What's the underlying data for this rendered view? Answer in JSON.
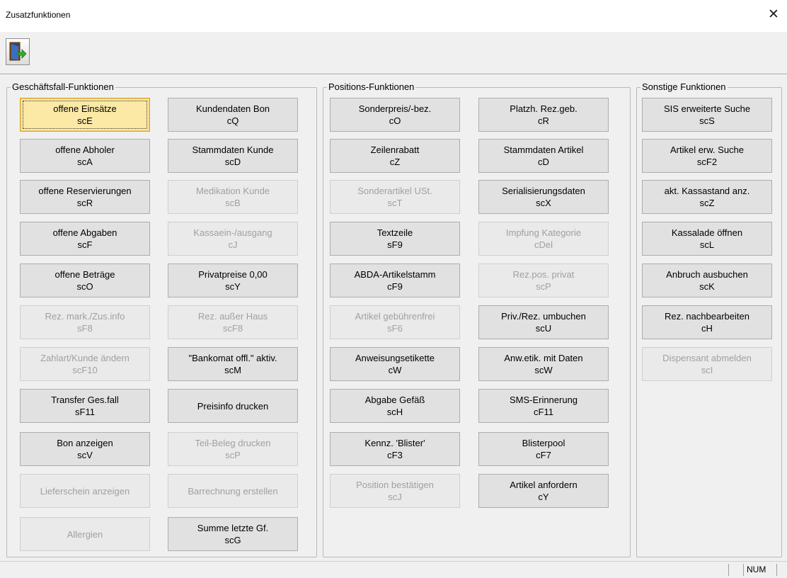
{
  "window": {
    "title": "Zusatzfunktionen",
    "close": "✕"
  },
  "toolbar": {
    "exit_icon": "exit-door-icon"
  },
  "groups": {
    "geschaeftsfall": {
      "label": "Geschäftsfall-Funktionen",
      "buttons": [
        {
          "line1": "offene Einsätze",
          "line2": "scE"
        },
        {
          "line1": "Kundendaten Bon",
          "line2": "cQ"
        },
        {
          "line1": "offene Abholer",
          "line2": "scA"
        },
        {
          "line1": "Stammdaten Kunde",
          "line2": "scD"
        },
        {
          "line1": "offene Reservierungen",
          "line2": "scR"
        },
        {
          "line1": "Medikation Kunde",
          "line2": "scB"
        },
        {
          "line1": "offene Abgaben",
          "line2": "scF"
        },
        {
          "line1": "Kassaein-/ausgang",
          "line2": "cJ"
        },
        {
          "line1": "offene Beträge",
          "line2": "scO"
        },
        {
          "line1": "Privatpreise 0,00",
          "line2": "scY"
        },
        {
          "line1": "Rez. mark./Zus.info",
          "line2": "sF8"
        },
        {
          "line1": "Rez. außer Haus",
          "line2": "scF8"
        },
        {
          "line1": "Zahlart/Kunde ändern",
          "line2": "scF10"
        },
        {
          "line1": "\"Bankomat offl.\" aktiv.",
          "line2": "scM"
        },
        {
          "line1": "Transfer Ges.fall",
          "line2": "sF11"
        },
        {
          "line1": "Preisinfo drucken",
          "line2": ""
        },
        {
          "line1": "Bon anzeigen",
          "line2": "scV"
        },
        {
          "line1": "Teil-Beleg drucken",
          "line2": "scP"
        },
        {
          "line1": "Lieferschein anzeigen",
          "line2": ""
        },
        {
          "line1": "Barrechnung erstellen",
          "line2": ""
        },
        {
          "line1": "Allergien",
          "line2": ""
        },
        {
          "line1": "Summe letzte Gf.",
          "line2": "scG"
        }
      ]
    },
    "positions": {
      "label": "Positions-Funktionen",
      "buttons": [
        {
          "line1": "Sonderpreis/-bez.",
          "line2": "cO"
        },
        {
          "line1": "Platzh. Rez.geb.",
          "line2": "cR"
        },
        {
          "line1": "Zeilenrabatt",
          "line2": "cZ"
        },
        {
          "line1": "Stammdaten Artikel",
          "line2": "cD"
        },
        {
          "line1": "Sonderartikel USt.",
          "line2": "scT"
        },
        {
          "line1": "Serialisierungsdaten",
          "line2": "scX"
        },
        {
          "line1": "Textzeile",
          "line2": "sF9"
        },
        {
          "line1": "Impfung Kategorie",
          "line2": "cDel"
        },
        {
          "line1": "ABDA-Artikelstamm",
          "line2": "cF9"
        },
        {
          "line1": "Rez.pos. privat",
          "line2": "scP"
        },
        {
          "line1": "Artikel gebührenfrei",
          "line2": "sF6"
        },
        {
          "line1": "Priv./Rez. umbuchen",
          "line2": "scU"
        },
        {
          "line1": "Anweisungsetikette",
          "line2": "cW"
        },
        {
          "line1": "Anw.etik. mit Daten",
          "line2": "scW"
        },
        {
          "line1": "Abgabe Gefäß",
          "line2": "scH"
        },
        {
          "line1": "SMS-Erinnerung",
          "line2": "cF11"
        },
        {
          "line1": "Kennz. 'Blister'",
          "line2": "cF3"
        },
        {
          "line1": "Blisterpool",
          "line2": "cF7"
        },
        {
          "line1": "Position bestätigen",
          "line2": "scJ"
        },
        {
          "line1": "Artikel anfordern",
          "line2": "cY"
        }
      ]
    },
    "sonstige": {
      "label": "Sonstige Funktionen",
      "buttons": [
        {
          "line1": "SIS erweiterte Suche",
          "line2": "scS"
        },
        {
          "line1": "Artikel erw. Suche",
          "line2": "scF2"
        },
        {
          "line1": "akt. Kassastand anz.",
          "line2": "scZ"
        },
        {
          "line1": "Kassalade öffnen",
          "line2": "scL"
        },
        {
          "line1": "Anbruch ausbuchen",
          "line2": "scK"
        },
        {
          "line1": "Rez. nachbearbeiten",
          "line2": "cH"
        },
        {
          "line1": "Dispensant abmelden",
          "line2": "scI"
        }
      ]
    }
  },
  "statusbar": {
    "num": "NUM"
  }
}
